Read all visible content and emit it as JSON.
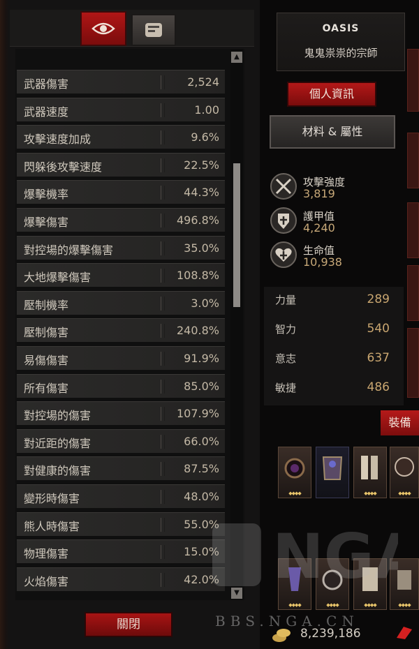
{
  "tabs": {
    "character_icon": "eye-icon",
    "inventory_icon": "scroll-bag-icon"
  },
  "stats": [
    {
      "label": "武器傷害",
      "value": "2,524"
    },
    {
      "label": "武器速度",
      "value": "1.00"
    },
    {
      "label": "攻擊速度加成",
      "value": "9.6%"
    },
    {
      "label": "閃躲後攻擊速度",
      "value": "22.5%"
    },
    {
      "label": "爆擊機率",
      "value": "44.3%"
    },
    {
      "label": "爆擊傷害",
      "value": "496.8%"
    },
    {
      "label": "對控場的爆擊傷害",
      "value": "35.0%"
    },
    {
      "label": "大地爆擊傷害",
      "value": "108.8%"
    },
    {
      "label": "壓制機率",
      "value": "3.0%"
    },
    {
      "label": "壓制傷害",
      "value": "240.8%"
    },
    {
      "label": "易傷傷害",
      "value": "91.9%"
    },
    {
      "label": "所有傷害",
      "value": "85.0%"
    },
    {
      "label": "對控場的傷害",
      "value": "107.9%"
    },
    {
      "label": "對近距的傷害",
      "value": "66.0%"
    },
    {
      "label": "對健康的傷害",
      "value": "87.5%"
    },
    {
      "label": "變形時傷害",
      "value": "48.0%"
    },
    {
      "label": "熊人時傷害",
      "value": "55.0%"
    },
    {
      "label": "物理傷害",
      "value": "15.0%"
    },
    {
      "label": "火焰傷害",
      "value": "42.0%"
    }
  ],
  "scroll": {
    "up": "▲",
    "down": "▼"
  },
  "close_button": "關閉",
  "character": {
    "name": "OASIS",
    "title": "鬼鬼祟祟的宗師",
    "profile_button": "個人資訊",
    "materials_button": "材料 & 屬性"
  },
  "core_stats": [
    {
      "icon": "crossed-swords-icon",
      "label": "攻擊強度",
      "value": "3,819"
    },
    {
      "icon": "shield-icon",
      "label": "護甲值",
      "value": "4,240"
    },
    {
      "icon": "heart-icon",
      "label": "生命值",
      "value": "10,938"
    }
  ],
  "attributes": [
    {
      "label": "力量",
      "value": "289"
    },
    {
      "label": "智力",
      "value": "540"
    },
    {
      "label": "意志",
      "value": "637"
    },
    {
      "label": "敏捷",
      "value": "486"
    }
  ],
  "equipment": {
    "tab_label": "裝備"
  },
  "gold": {
    "value": "8,239,186",
    "icon": "gold-coins-icon"
  },
  "watermark": "BBS.NGA.CN",
  "colors": {
    "accent_red": "#b01616",
    "gold_text": "#c9a670"
  }
}
